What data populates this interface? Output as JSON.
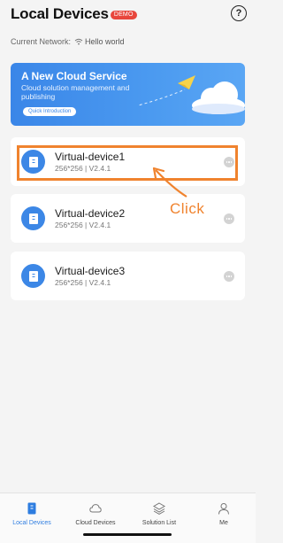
{
  "header": {
    "title": "Local Devices",
    "badge": "DEMO",
    "help_icon": "question-circle-icon"
  },
  "network": {
    "label": "Current Network:",
    "ssid": "Hello world",
    "icon": "wifi-icon"
  },
  "banner": {
    "title": "A New Cloud Service",
    "subtitle": "Cloud solution management and publishing",
    "button_label": "Quick Introduction"
  },
  "devices": [
    {
      "name": "Virtual-device1",
      "spec": "256*256 | V2.4.1"
    },
    {
      "name": "Virtual-device2",
      "spec": "256*256 | V2.4.1"
    },
    {
      "name": "Virtual-device3",
      "spec": "256*256 | V2.4.1"
    }
  ],
  "annotation": {
    "label": "Click",
    "color": "#f0832e"
  },
  "tabbar": {
    "tabs": [
      {
        "label": "Local Devices",
        "icon": "device-icon",
        "active": true
      },
      {
        "label": "Cloud Devices",
        "icon": "cloud-icon",
        "active": false
      },
      {
        "label": "Solution List",
        "icon": "layers-icon",
        "active": false
      },
      {
        "label": "Me",
        "icon": "person-icon",
        "active": false
      }
    ]
  },
  "colors": {
    "accent": "#3c87e6",
    "badge": "#e8463c",
    "annotation": "#f0832e",
    "background": "#f4f4f4"
  }
}
